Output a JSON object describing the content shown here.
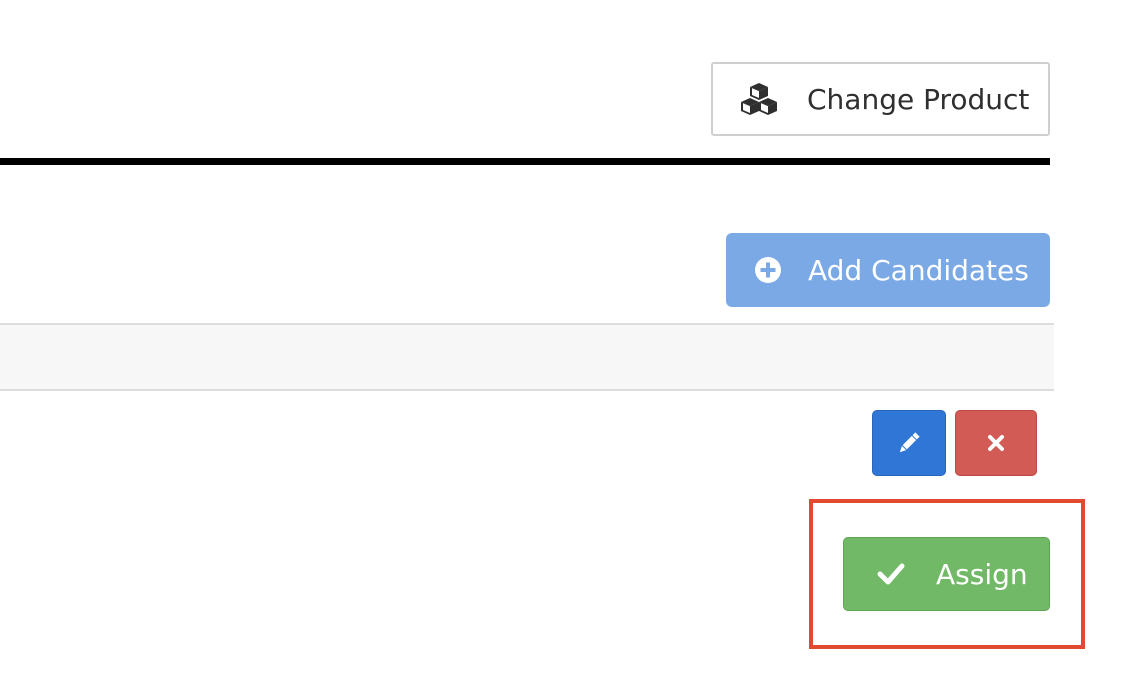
{
  "header": {
    "change_product_label": "Change Product",
    "change_product_icon": "cubes-icon"
  },
  "candidates": {
    "add_label": "Add Candidates",
    "add_icon": "plus-circle-icon"
  },
  "row_actions": {
    "edit_icon": "pencil-icon",
    "delete_icon": "close-icon"
  },
  "assign": {
    "label": "Assign",
    "icon": "check-icon"
  },
  "colors": {
    "primary": "#2f76d6",
    "primary_light": "#7aa9e6",
    "danger": "#d35b55",
    "success": "#72b967",
    "highlight": "#e04a2f"
  }
}
